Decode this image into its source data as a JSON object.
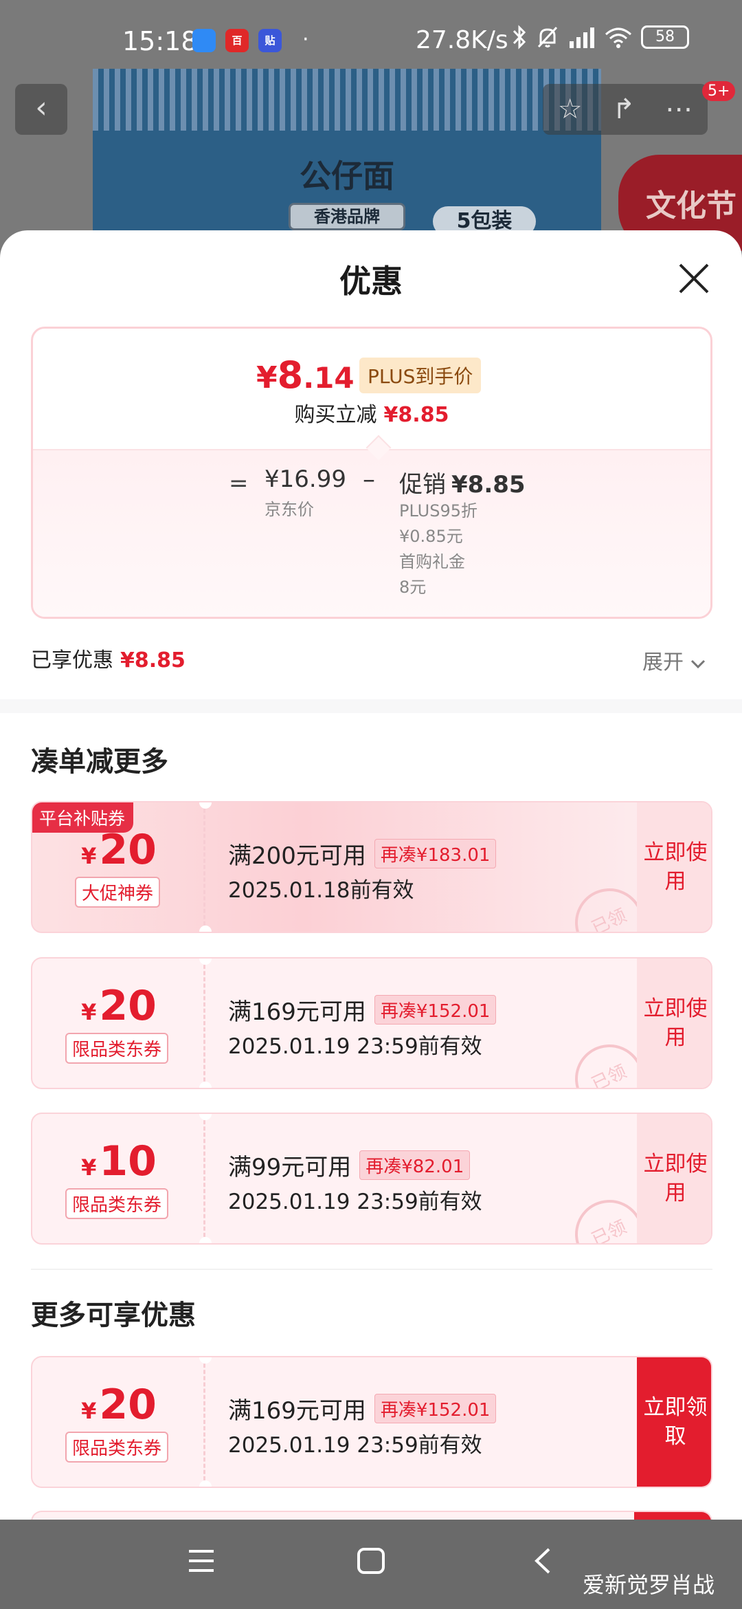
{
  "status_bar": {
    "time": "15:18",
    "app_icons": [
      {
        "name": "chat-app",
        "label": "",
        "color": "#2f8af5"
      },
      {
        "name": "news-app",
        "label": "百",
        "color": "#e02828"
      },
      {
        "name": "tieba-app",
        "label": "贴",
        "color": "#3b57d9"
      }
    ],
    "net_speed": "27.8K/s",
    "battery": "58",
    "signal_icons": [
      "bluetooth-icon",
      "mute-icon",
      "signal-icon",
      "wifi-icon"
    ]
  },
  "background": {
    "brand": "公仔面",
    "brand_sub": "香港品牌",
    "pack": "5包装",
    "badge": "文化节",
    "notification_count": "5+"
  },
  "sheet": {
    "title": "优惠",
    "price_card": {
      "currency": "¥",
      "final_int": "8",
      "final_dec": ".14",
      "plus_tag": "PLUS到手价",
      "buy_reduce_label": "购买立减",
      "buy_reduce_amount": "¥8.85",
      "equals": "=",
      "jd_price": "¥16.99",
      "jd_label": "京东价",
      "minus": "–",
      "promo_label": "促销",
      "promo_amount": "¥8.85",
      "promo_lines": [
        "PLUS95折",
        "¥0.85元",
        "首购礼金",
        "8元"
      ]
    },
    "enjoyed_label": "已享优惠",
    "enjoyed_amount": "¥8.85",
    "expand_label": "展开",
    "section1_title": "凑单减更多",
    "section2_title": "更多可享优惠",
    "coupons": [
      {
        "currency": "¥",
        "amount": "20",
        "type": "大促神券",
        "tag": "平台补贴券",
        "condition": "满200元可用",
        "more": "再凑¥183.01",
        "valid": "2025.01.18前有效",
        "action": "立即使用",
        "stamp": "已领"
      },
      {
        "currency": "¥",
        "amount": "20",
        "type": "限品类东券",
        "condition": "满169元可用",
        "more": "再凑¥152.01",
        "valid": "2025.01.19 23:59前有效",
        "action": "立即使用",
        "stamp": "已领"
      },
      {
        "currency": "¥",
        "amount": "10",
        "type": "限品类东券",
        "condition": "满99元可用",
        "more": "再凑¥82.01",
        "valid": "2025.01.19 23:59前有效",
        "action": "立即使用",
        "stamp": "已领"
      },
      {
        "currency": "¥",
        "amount": "20",
        "type": "限品类东券",
        "condition": "满169元可用",
        "more": "再凑¥152.01",
        "valid": "2025.01.19 23:59前有效",
        "action": "立即领取"
      }
    ]
  },
  "navbar": {
    "watermark": "爱新觉罗肖战"
  },
  "colors": {
    "accent": "#e31d2e",
    "coupon_bg": "#fff1f3",
    "plus_tag_bg": "#fde8c9"
  }
}
